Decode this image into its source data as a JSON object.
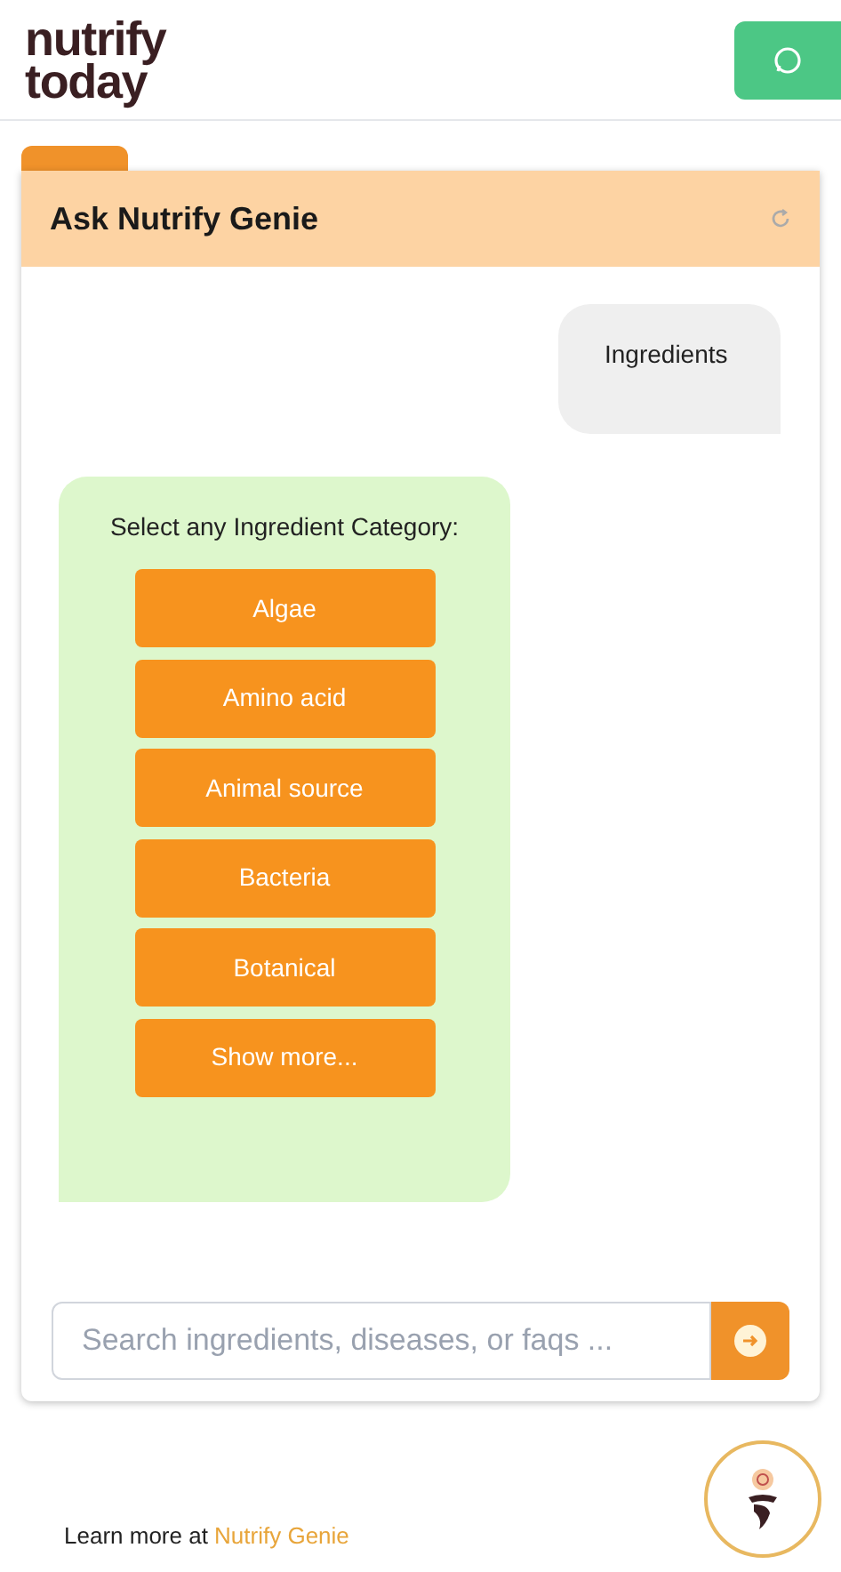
{
  "logo": {
    "lines": [
      "nutrify",
      "today"
    ]
  },
  "chat": {
    "title": "Ask Nutrify Genie",
    "messages": [
      {
        "kind": "user",
        "text": "Ingredients"
      },
      {
        "kind": "options",
        "text": "Select any Ingredient Category:",
        "options": [
          "Algae",
          "Amino acid",
          "Animal source",
          "Bacteria",
          "Botanical",
          "Show more..."
        ]
      }
    ],
    "input": {
      "placeholder": "Search ingredients, diseases, or faqs ..."
    }
  },
  "footer": {
    "text": "Learn more at ",
    "link": "Nutrify Genie"
  }
}
